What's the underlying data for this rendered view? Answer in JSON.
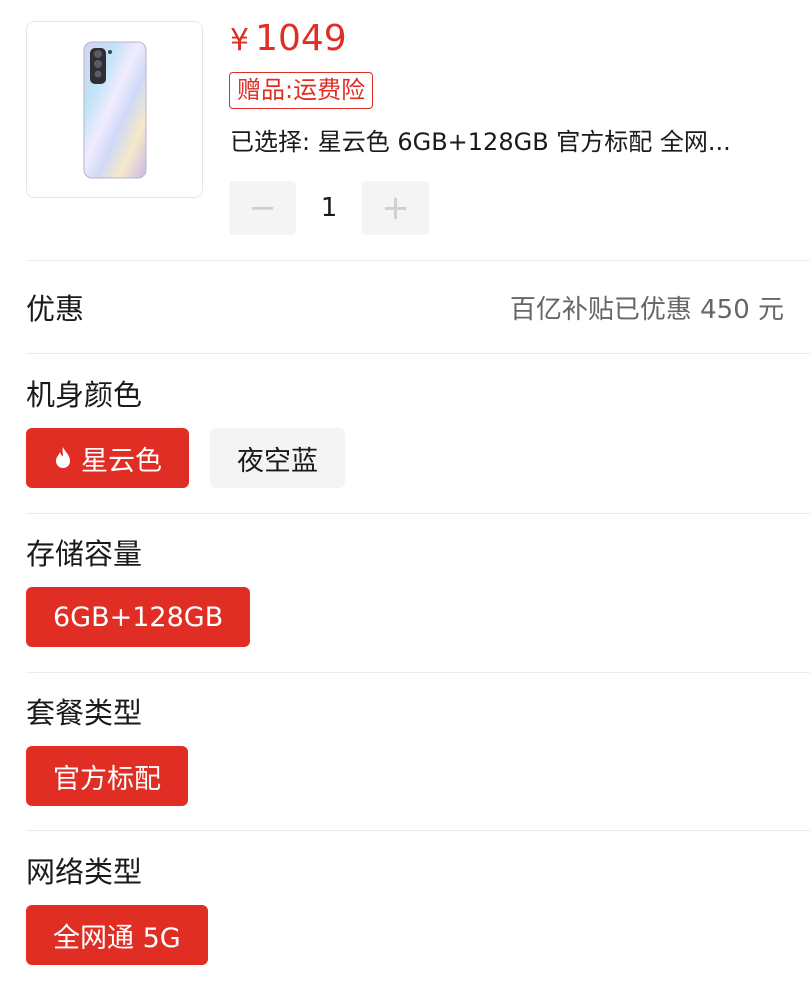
{
  "product": {
    "currency_symbol": "¥",
    "price": "1049",
    "gift_tag": "赠品:运费险",
    "selected_summary": "已选择: 星云色 6GB+128GB 官方标配 全网...",
    "quantity": "1",
    "minus_label": "−",
    "plus_label": "+"
  },
  "discount": {
    "label": "优惠",
    "value": "百亿补贴已优惠 450 元"
  },
  "options": {
    "color": {
      "title": "机身颜色",
      "items": [
        {
          "label": "星云色",
          "selected": true,
          "icon": "fire-icon"
        },
        {
          "label": "夜空蓝",
          "selected": false
        }
      ]
    },
    "storage": {
      "title": "存储容量",
      "items": [
        {
          "label": "6GB+128GB",
          "selected": true
        }
      ]
    },
    "package": {
      "title": "套餐类型",
      "items": [
        {
          "label": "官方标配",
          "selected": true
        }
      ]
    },
    "network": {
      "title": "网络类型",
      "items": [
        {
          "label": "全网通 5G",
          "selected": true
        }
      ]
    }
  },
  "colors": {
    "accent": "#e02e24",
    "chip_bg": "#f4f4f4"
  }
}
